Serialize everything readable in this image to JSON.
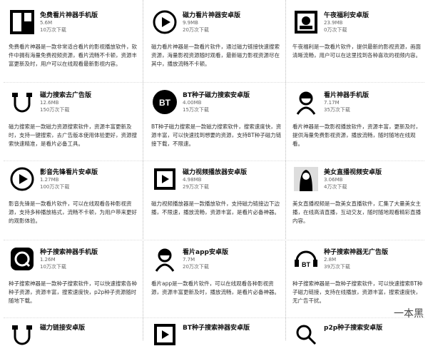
{
  "cards": [
    {
      "title": "免费看片神器手机版",
      "size": "5.6M",
      "downloads": "10万次下载",
      "desc": "免费看片神器是一款非常适合看片的影视播放软件，软件中拥有海量免费视频资源，看片流畅不卡顿，资源丰富更新及时，用户可以在线观看最新影视内容。",
      "icon": "photo-thumb-icon"
    },
    {
      "title": "磁力看片神器安卓版",
      "size": "9.9MB",
      "downloads": "20万次下载",
      "desc": "磁力看片神器是一款看片软件，通过磁力链接快速搜索资源，海量影视资源随时观看，最新磁力影视资源尽在其中，播放流畅不卡顿。",
      "icon": "play-circle-icon"
    },
    {
      "title": "午夜福利安卓版",
      "size": "23.9MB",
      "downloads": "0万次下载",
      "desc": "午夜福利是一款看片软件，提供最新的影视资源，画面清晰流畅，用户可以在这里找到各种喜欢的视频内容。",
      "icon": "album-art-icon"
    },
    {
      "title": "磁力搜索去广告版",
      "size": "12.6MB",
      "downloads": "150万次下载",
      "desc": "磁力搜索是一款磁力资源搜索软件，资源丰富更新及时，支持一键搜索，去广告版本使用体验更好，资源搜索快速精准，是看片必备工具。",
      "icon": "magnet-icon"
    },
    {
      "title": "BT种子磁力搜索安卓版",
      "size": "4.00MB",
      "downloads": "15万次下载",
      "desc": "BT种子磁力搜索是一款磁力搜索软件，搜索速度快，资源丰富，可以快速找到想要的资源，支持BT种子磁力链接下载，不限速。",
      "icon": "bt-logo-icon"
    },
    {
      "title": "看片神器手机版",
      "size": "7.17M",
      "downloads": "35万次下载",
      "desc": "看片神器是一款影视播放软件，资源丰富，更新及时，提供海量免费影视资源，播放流畅，随时随地在线观看。",
      "icon": "avatar-girl-icon"
    },
    {
      "title": "影音先锋看片安卓版",
      "size": "1.27MB",
      "downloads": "100万次下载",
      "desc": "影音先锋是一款看片软件，可以在线观看各种影视资源，支持多种播放格式，流畅不卡顿，为用户带来更好的观影体验。",
      "icon": "play-circle-icon"
    },
    {
      "title": "磁力视频播放器安卓版",
      "size": "4.98MB",
      "downloads": "29万次下载",
      "desc": "磁力视频播放器是一款播放软件，支持磁力链接边下边播，不限速，播放流畅，资源丰富，是看片必备神器。",
      "icon": "play-square-icon"
    },
    {
      "title": "美女直播视频安卓版",
      "size": "3.06MB",
      "downloads": "4万次下载",
      "desc": "美女直播视频是一款美女直播软件，汇集了大量美女主播，在线高清直播，互动交友，随时随地观看精彩直播内容。",
      "icon": "girl-photo-icon"
    },
    {
      "title": "种子搜索神器手机版",
      "size": "1.26M",
      "downloads": "10万次下载",
      "desc": "种子搜索神器是一款种子搜索软件，可以快速搜索各种种子资源，资源丰富，搜索速度快，p2p种子资源随时随地下载。",
      "icon": "seed-search-icon"
    },
    {
      "title": "看片app安卓版",
      "size": "7.7M",
      "downloads": "20万次下载",
      "desc": "看片app是一款看片软件，可以在线观看各种影视资源，资源丰富更新及时，播放流畅，是看片必备神器。",
      "icon": "cartoon-girl-icon"
    },
    {
      "title": "种子搜索神器无广告版",
      "size": "2.8M",
      "downloads": "39万次下载",
      "desc": "种子搜索神器是一款种子搜索软件，可以快速搜索BT种子磁力链接，支持在线播放，资源丰富，搜索速度快，无广告干扰。",
      "icon": "bt-robot-icon"
    },
    {
      "title": "磁力链接安卓版",
      "size": "",
      "downloads": "",
      "desc": "",
      "icon": "magnet-icon"
    },
    {
      "title": "BT种子搜索神器安卓版",
      "size": "",
      "downloads": "",
      "desc": "",
      "icon": "play-square-icon"
    },
    {
      "title": "p2p种子搜索安卓版",
      "size": "",
      "downloads": "",
      "desc": "",
      "icon": "search-icon"
    }
  ],
  "watermark": "一本黑"
}
